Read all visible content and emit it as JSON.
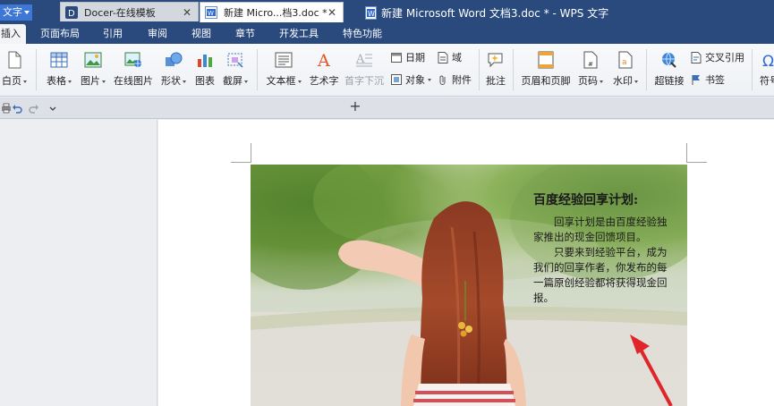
{
  "titlebar": {
    "app_button_label": "文字",
    "window_title": "新建 Microsoft Word 文档3.doc * - WPS 文字"
  },
  "menu": {
    "tabs": [
      {
        "label": "插入",
        "active": true
      },
      {
        "label": "页面布局"
      },
      {
        "label": "引用"
      },
      {
        "label": "审阅"
      },
      {
        "label": "视图"
      },
      {
        "label": "章节"
      },
      {
        "label": "开发工具"
      },
      {
        "label": "特色功能"
      }
    ]
  },
  "ribbon": {
    "blank_page": "白页",
    "table": "表格",
    "picture": "图片",
    "online_picture": "在线图片",
    "shape": "形状",
    "chart": "图表",
    "screenshot": "截屏",
    "textbox": "文本框",
    "wordart": "艺术字",
    "drop_cap": "首字下沉",
    "date": "日期",
    "field": "域",
    "object": "对象",
    "attachment": "附件",
    "comment": "批注",
    "header_footer": "页眉和页脚",
    "page_number": "页码",
    "watermark": "水印",
    "hyperlink": "超链接",
    "cross_reference": "交叉引用",
    "bookmark": "书签",
    "symbol": "符号"
  },
  "tabs": {
    "docer": "Docer-在线模板",
    "document": "新建 Micro...档3.doc *",
    "close_glyph": "✕",
    "new_tab_glyph": "+"
  },
  "document": {
    "textbox_title": "百度经验回享计划:",
    "paragraph1": "回享计划是由百度经验独家推出的现金回馈项目。",
    "paragraph2": "只要来到经验平台，成为我们的回享作者，你发布的每一篇原创经验都将获得现金回报。"
  },
  "icons": {
    "document_tab": "doc-icon",
    "docer_tab": "docer-icon"
  },
  "colors": {
    "titlebar": "#2a4a7e",
    "app_button": "#3d78d6",
    "arrow": "#e0262b"
  }
}
